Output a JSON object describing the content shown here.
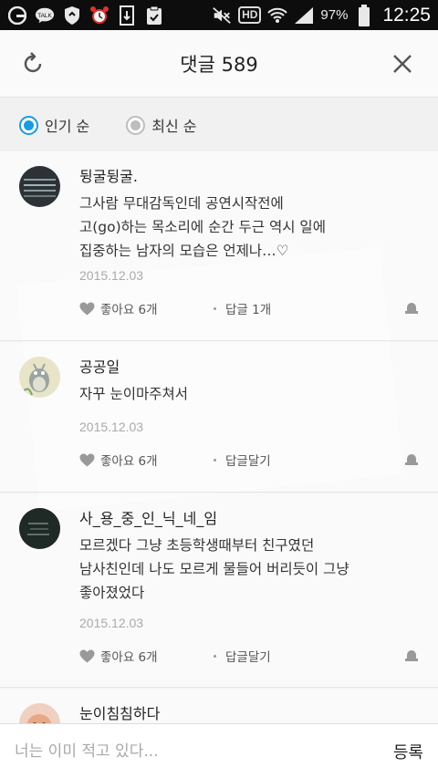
{
  "status_bar": {
    "kakao_badge": "TALK",
    "hd_label": "HD",
    "battery_percent": "97%",
    "time": "12:25",
    "icons": [
      "app-g-icon",
      "kakaotalk-icon",
      "shield-icon",
      "alarm-clock-icon",
      "download-icon",
      "clipboard-check-icon",
      "mute-icon",
      "hd-icon",
      "wifi-icon",
      "signal-icon",
      "battery-icon"
    ]
  },
  "header": {
    "title": "댓글 589",
    "icons": {
      "refresh": "refresh-icon",
      "close": "close-icon"
    }
  },
  "sort": {
    "options": [
      {
        "label": "인기 순",
        "selected": true
      },
      {
        "label": "최신 순",
        "selected": false
      }
    ]
  },
  "comments": [
    {
      "author": "뒹굴뒹굴.",
      "lines": [
        "그사람 무대감독인데 공연시작전에",
        "고(go)하는 목소리에 순간 두근 역시 일에",
        "집중하는 남자의 모습은 언제나…♡"
      ],
      "date": "2015.12.03",
      "likes": "좋아요 6개",
      "replies": "답글 1개"
    },
    {
      "author": "공공일",
      "lines": [
        "자꾸 눈이마주쳐서"
      ],
      "date": "2015.12.03",
      "likes": "좋아요 6개",
      "replies": "답글달기"
    },
    {
      "author": "사_용_중_인_닉_네_임",
      "lines": [
        "모르겠다 그냥 초등학생때부터 친구였던",
        "남사친인데 나도 모르게 물들어 버리듯이 그냥",
        "좋아졌었다"
      ],
      "date": "2015.12.03",
      "likes": "좋아요 6개",
      "replies": "답글달기"
    },
    {
      "author": "눈이침침하다",
      "lines": [],
      "date": "",
      "likes": "",
      "replies": ""
    }
  ],
  "input": {
    "placeholder": "너는 이미 적고 있다...",
    "value": "",
    "submit_label": "등록"
  },
  "colors": {
    "accent": "#1a9be0",
    "status_bar_bg": "#0d0d0d",
    "header_bg": "#fafafa",
    "date_text": "#aaaaaa"
  }
}
